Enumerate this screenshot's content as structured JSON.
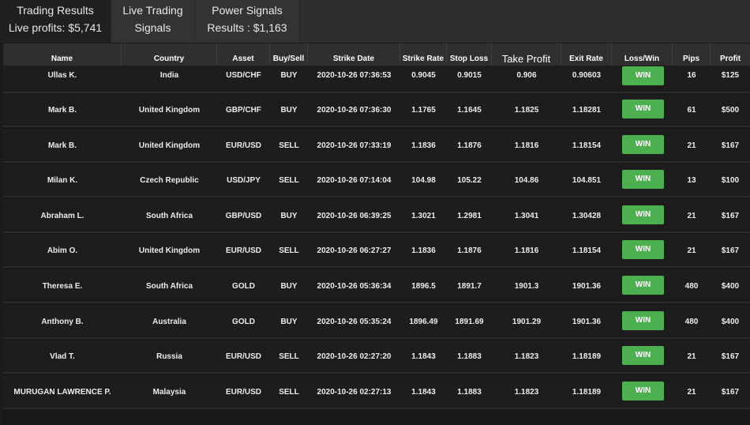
{
  "tabs": [
    {
      "line1": "Trading Results",
      "line2": "Live profits: $5,741"
    },
    {
      "line1": "Live Trading",
      "line2": "Signals"
    },
    {
      "line1": "Power Signals",
      "line2": "Results : $1,163"
    }
  ],
  "columns": [
    "Name",
    "Country",
    "Asset",
    "Buy/Sell",
    "Strike Date",
    "Strike Rate",
    "Stop Loss",
    "Take Profit",
    "Exit Rate",
    "Loss/Win",
    "Pips",
    "Profit"
  ],
  "rows": [
    {
      "name": "Ullas K.",
      "country": "India",
      "asset": "USD/CHF",
      "side": "BUY",
      "date": "2020-10-26 07:36:53",
      "strike": "0.9045",
      "stop": "0.9015",
      "take": "0.906",
      "exit": "0.90603",
      "result": "WIN",
      "pips": "16",
      "profit": "$125"
    },
    {
      "name": "Mark B.",
      "country": "United Kingdom",
      "asset": "GBP/CHF",
      "side": "BUY",
      "date": "2020-10-26 07:36:30",
      "strike": "1.1765",
      "stop": "1.1645",
      "take": "1.1825",
      "exit": "1.18281",
      "result": "WIN",
      "pips": "61",
      "profit": "$500"
    },
    {
      "name": "Mark B.",
      "country": "United Kingdom",
      "asset": "EUR/USD",
      "side": "SELL",
      "date": "2020-10-26 07:33:19",
      "strike": "1.1836",
      "stop": "1.1876",
      "take": "1.1816",
      "exit": "1.18154",
      "result": "WIN",
      "pips": "21",
      "profit": "$167"
    },
    {
      "name": "Milan K.",
      "country": "Czech Republic",
      "asset": "USD/JPY",
      "side": "SELL",
      "date": "2020-10-26 07:14:04",
      "strike": "104.98",
      "stop": "105.22",
      "take": "104.86",
      "exit": "104.851",
      "result": "WIN",
      "pips": "13",
      "profit": "$100"
    },
    {
      "name": "Abraham L.",
      "country": "South Africa",
      "asset": "GBP/USD",
      "side": "BUY",
      "date": "2020-10-26 06:39:25",
      "strike": "1.3021",
      "stop": "1.2981",
      "take": "1.3041",
      "exit": "1.30428",
      "result": "WIN",
      "pips": "21",
      "profit": "$167"
    },
    {
      "name": "Abim O.",
      "country": "United Kingdom",
      "asset": "EUR/USD",
      "side": "SELL",
      "date": "2020-10-26 06:27:27",
      "strike": "1.1836",
      "stop": "1.1876",
      "take": "1.1816",
      "exit": "1.18154",
      "result": "WIN",
      "pips": "21",
      "profit": "$167"
    },
    {
      "name": "Theresa E.",
      "country": "South Africa",
      "asset": "GOLD",
      "side": "BUY",
      "date": "2020-10-26 05:36:34",
      "strike": "1896.5",
      "stop": "1891.7",
      "take": "1901.3",
      "exit": "1901.36",
      "result": "WIN",
      "pips": "480",
      "profit": "$400"
    },
    {
      "name": "Anthony B.",
      "country": "Australia",
      "asset": "GOLD",
      "side": "BUY",
      "date": "2020-10-26 05:35:24",
      "strike": "1896.49",
      "stop": "1891.69",
      "take": "1901.29",
      "exit": "1901.36",
      "result": "WIN",
      "pips": "480",
      "profit": "$400"
    },
    {
      "name": "Vlad T.",
      "country": "Russia",
      "asset": "EUR/USD",
      "side": "SELL",
      "date": "2020-10-26 02:27:20",
      "strike": "1.1843",
      "stop": "1.1883",
      "take": "1.1823",
      "exit": "1.18189",
      "result": "WIN",
      "pips": "21",
      "profit": "$167"
    },
    {
      "name": "MURUGAN LAWRENCE P.",
      "country": "Malaysia",
      "asset": "EUR/USD",
      "side": "SELL",
      "date": "2020-10-26 02:27:13",
      "strike": "1.1843",
      "stop": "1.1883",
      "take": "1.1823",
      "exit": "1.18189",
      "result": "WIN",
      "pips": "21",
      "profit": "$167"
    }
  ],
  "colors": {
    "win": "#4caf50",
    "header_bg": "#2f2f2f",
    "row_bg": "#1d1d1d"
  }
}
